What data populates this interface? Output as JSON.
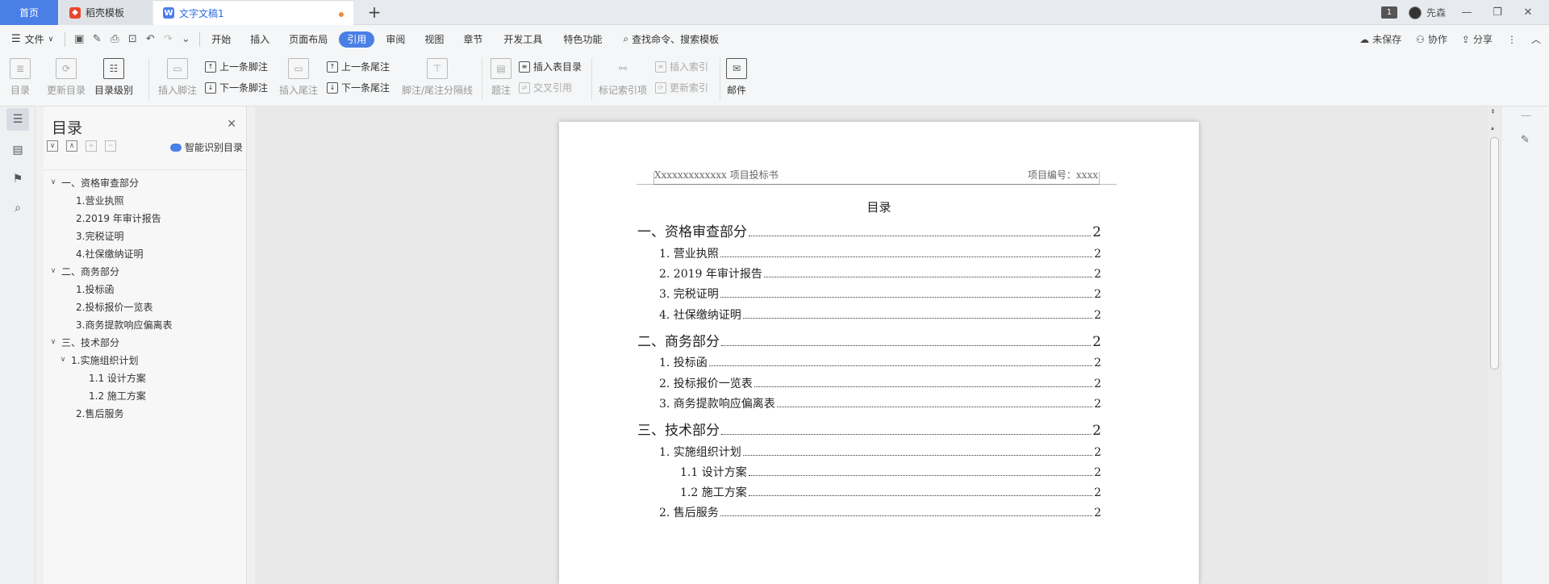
{
  "tabs": {
    "home": "首页",
    "template": "稻壳模板",
    "doc": "文字文稿1"
  },
  "titlebar": {
    "page_badge": "1",
    "user": "先森",
    "minimize": "—",
    "restore": "❐",
    "close": "✕"
  },
  "menu": {
    "file": "文件",
    "items": [
      "开始",
      "插入",
      "页面布局",
      "引用",
      "审阅",
      "视图",
      "章节",
      "开发工具",
      "特色功能"
    ],
    "active_index": 3,
    "search": "查找命令、搜索模板",
    "unsaved": "未保存",
    "collab": "协作",
    "share": "分享"
  },
  "ribbon": {
    "toc": "目录",
    "update_toc": "更新目录",
    "toc_level": "目录级别",
    "insert_footnote": "插入脚注",
    "prev_footnote": "上一条脚注",
    "next_footnote": "下一条脚注",
    "insert_endnote": "插入尾注",
    "prev_endnote": "上一条尾注",
    "next_endnote": "下一条尾注",
    "separator_line": "脚注/尾注分隔线",
    "caption": "题注",
    "insert_table_toc": "插入表目录",
    "cross_ref": "交叉引用",
    "mark_index": "标记索引项",
    "insert_index": "插入索引",
    "update_index": "更新索引",
    "mail": "邮件"
  },
  "nav": {
    "title": "目录",
    "smart": "智能识别目录",
    "items": [
      {
        "label": "一、资格审查部分",
        "level": 1,
        "chev": "∨"
      },
      {
        "label": "1.营业执照",
        "level": 2,
        "chev": ""
      },
      {
        "label": "2.2019 年审计报告",
        "level": 2,
        "chev": ""
      },
      {
        "label": "3.完税证明",
        "level": 2,
        "chev": ""
      },
      {
        "label": "4.社保缴纳证明",
        "level": 2,
        "chev": ""
      },
      {
        "label": "二、商务部分",
        "level": 1,
        "chev": "∨"
      },
      {
        "label": "1.投标函",
        "level": 2,
        "chev": ""
      },
      {
        "label": "2.投标报价一览表",
        "level": 2,
        "chev": ""
      },
      {
        "label": "3.商务提款响应偏离表",
        "level": 2,
        "chev": ""
      },
      {
        "label": "三、技术部分",
        "level": 1,
        "chev": "∨"
      },
      {
        "label": "1.实施组织计划",
        "level": 2,
        "chev": "∨"
      },
      {
        "label": "1.1 设计方案",
        "level": 3,
        "chev": ""
      },
      {
        "label": "1.2 施工方案",
        "level": 3,
        "chev": ""
      },
      {
        "label": "2.售后服务",
        "level": 2,
        "chev": ""
      }
    ]
  },
  "document": {
    "header_left": "Xxxxxxxxxxxxx 项目投标书",
    "header_right": "项目编号：xxxx",
    "toc_title": "目录",
    "toc": [
      {
        "label": "一、资格审查部分",
        "page": "2",
        "level": 1
      },
      {
        "label": "1. 营业执照",
        "page": "2",
        "level": 2
      },
      {
        "label": "2. 2019 年审计报告",
        "page": "2",
        "level": 2
      },
      {
        "label": "3. 完税证明",
        "page": "2",
        "level": 2
      },
      {
        "label": "4. 社保缴纳证明",
        "page": "2",
        "level": 2
      },
      {
        "label": "二、商务部分",
        "page": "2",
        "level": 1
      },
      {
        "label": "1. 投标函",
        "page": "2",
        "level": 2
      },
      {
        "label": "2. 投标报价一览表",
        "page": "2",
        "level": 2
      },
      {
        "label": "3. 商务提款响应偏离表",
        "page": "2",
        "level": 2
      },
      {
        "label": "三、技术部分",
        "page": "2",
        "level": 1
      },
      {
        "label": "1. 实施组织计划",
        "page": "2",
        "level": 2
      },
      {
        "label": "1.1 设计方案",
        "page": "2",
        "level": 3
      },
      {
        "label": "1.2 施工方案",
        "page": "2",
        "level": 3
      },
      {
        "label": "2. 售后服务",
        "page": "2",
        "level": 2
      }
    ]
  },
  "colors": {
    "accent": "#4a7fe6",
    "modified_dot": "#f08a3c"
  }
}
